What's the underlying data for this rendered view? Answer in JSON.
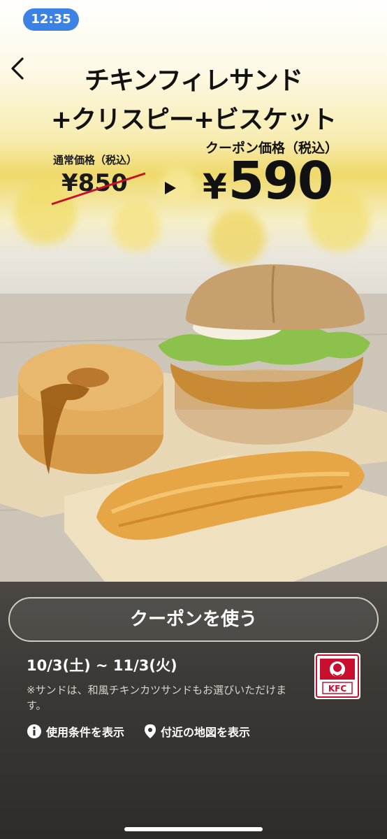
{
  "status_bar": {
    "time": "12:35"
  },
  "nav": {
    "back_icon": "chevron-left-icon"
  },
  "offer": {
    "title_line1": "チキンフィレサンド",
    "title_line2": "+クリスピー+ビスケット",
    "regular_price_label": "通常価格（税込）",
    "regular_price": "¥850",
    "coupon_price_label": "クーポン価格（税込）",
    "coupon_currency": "¥",
    "coupon_price_value": "590"
  },
  "actions": {
    "use_coupon_label": "クーポンを使う",
    "terms_label": "使用条件を表示",
    "map_label": "付近の地図を表示"
  },
  "details": {
    "validity": "10/3(土) ~ 11/3(火)",
    "note": "※サンドは、和風チキンカツサンドもお選びいただけます。"
  },
  "brand": {
    "logo_text": "KFC"
  },
  "colors": {
    "time_pill": "#3b82e4",
    "brand_red": "#c8102e"
  }
}
